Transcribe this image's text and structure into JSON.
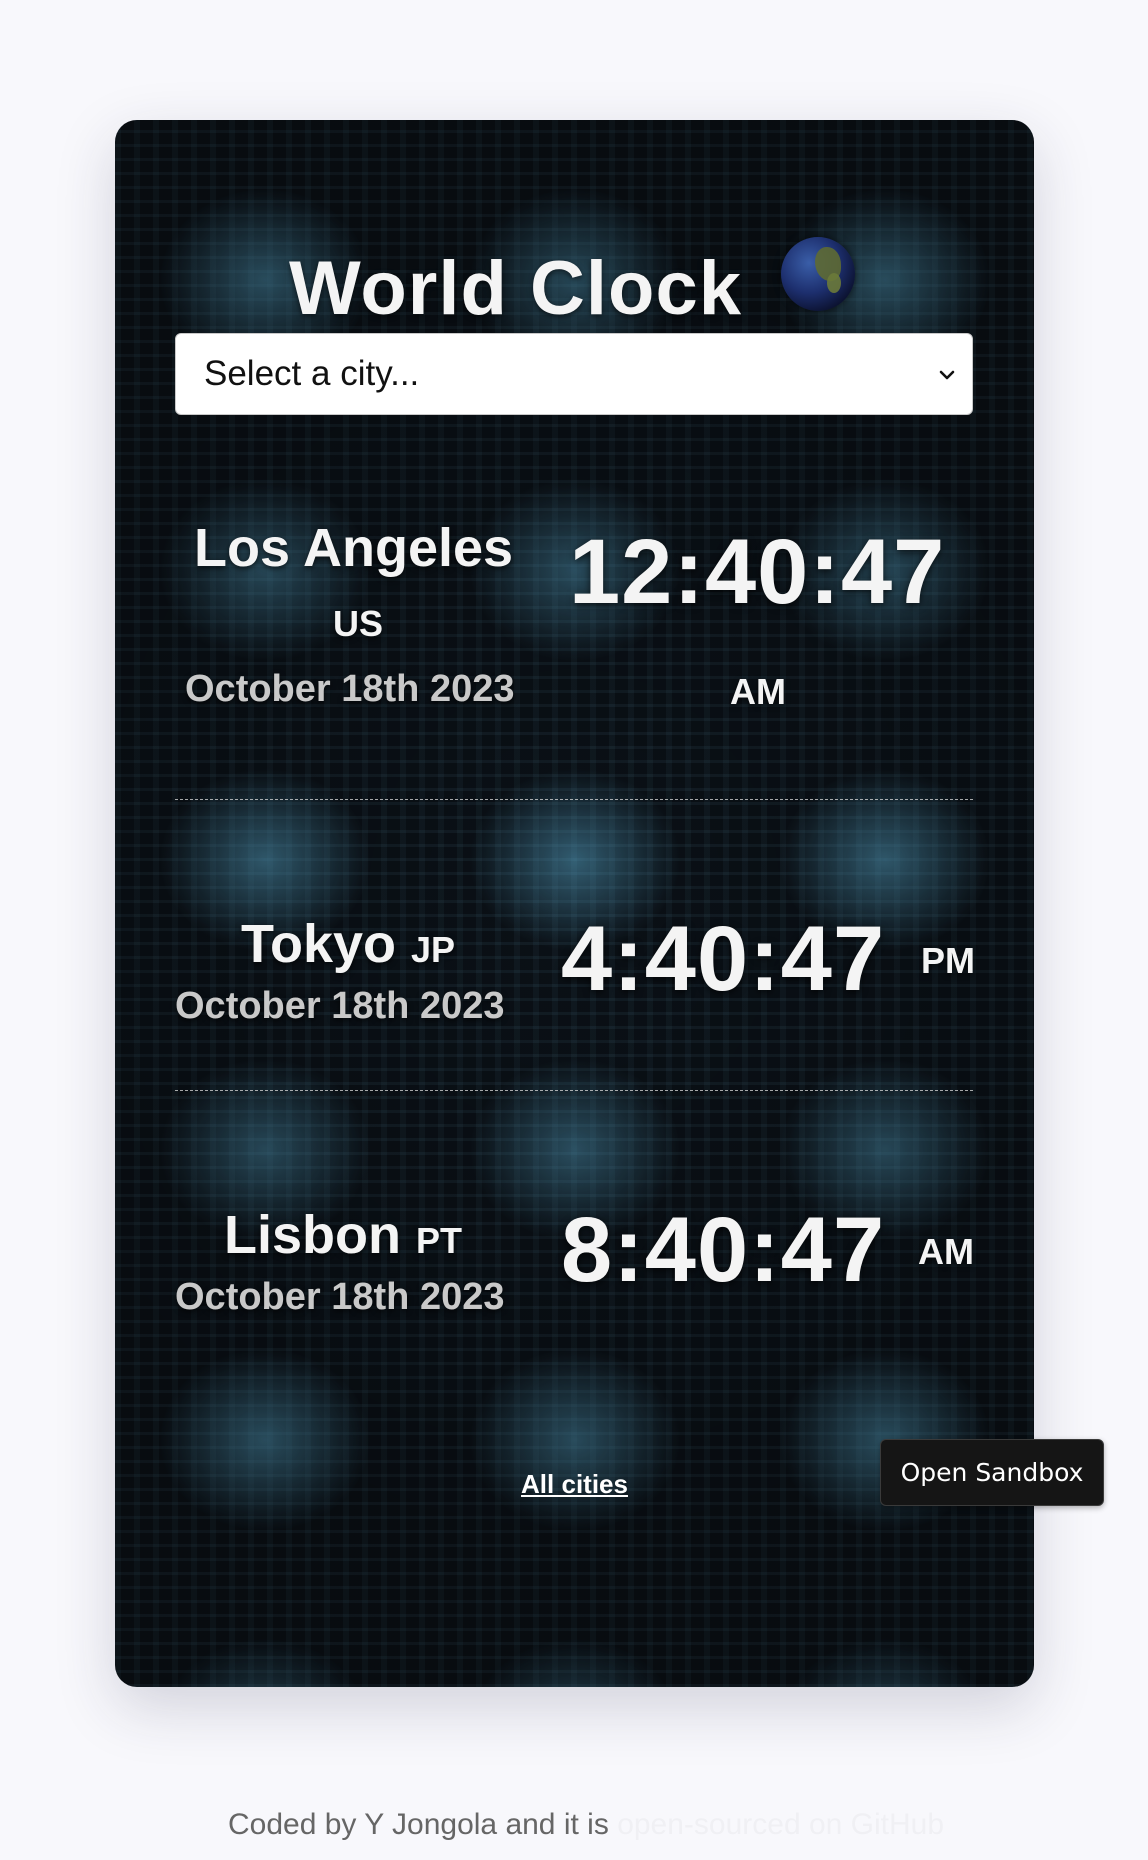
{
  "header": {
    "title": "World Clock"
  },
  "city_select": {
    "placeholder": "Select a city..."
  },
  "cities": [
    {
      "name": "Los Angeles",
      "country": "US",
      "date": "October 18th 2023",
      "time": "12:40:47",
      "period": "AM"
    },
    {
      "name": "Tokyo",
      "country": "JP",
      "date": "October 18th 2023",
      "time": "4:40:47",
      "period": "PM"
    },
    {
      "name": "Lisbon",
      "country": "PT",
      "date": "October 18th 2023",
      "time": "8:40:47",
      "period": "AM"
    }
  ],
  "links": {
    "all_cities": "All cities"
  },
  "sandbox": {
    "label": "Open Sandbox"
  },
  "footer": {
    "text": "Coded by Y Jongola and it is",
    "link": "open-sourced on GitHub"
  }
}
